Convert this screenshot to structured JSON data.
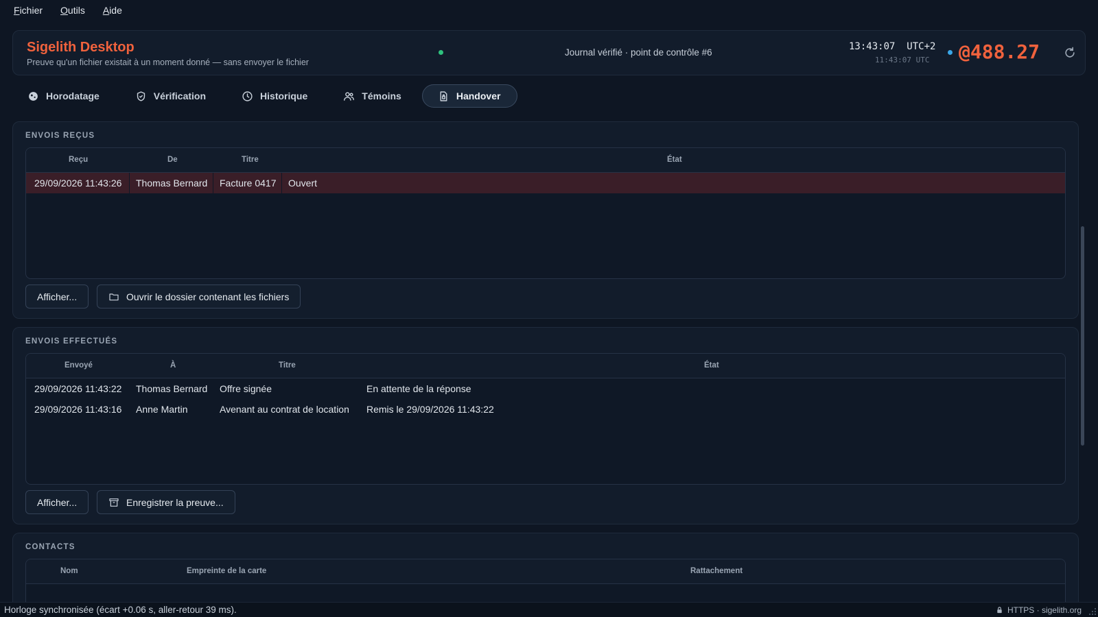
{
  "menu": [
    "Fichier",
    "Outils",
    "Aide"
  ],
  "header": {
    "title": "Sigelith Desktop",
    "subtitle": "Preuve qu'un fichier existait à un moment donné — sans envoyer le fichier",
    "journal": "Journal vérifié · point de contrôle #6",
    "clock_local": "13:43:07  UTC+2",
    "clock_utc": "11:43:07 UTC",
    "counter": "@488.27",
    "colors": {
      "accent": "#f0623d",
      "ok": "#2ec27e",
      "info": "#3aa7e8"
    }
  },
  "tabs": [
    {
      "label": "Horodatage",
      "icon": "seal-icon"
    },
    {
      "label": "Vérification",
      "icon": "shield-check-icon"
    },
    {
      "label": "Historique",
      "icon": "clock-icon"
    },
    {
      "label": "Témoins",
      "icon": "users-icon"
    },
    {
      "label": "Handover",
      "icon": "lock-file-icon",
      "active": true
    }
  ],
  "received": {
    "title": "ENVOIS REÇUS",
    "columns": [
      "Reçu",
      "De",
      "Titre",
      "État"
    ],
    "rows": [
      [
        "29/09/2026 11:43:26",
        "Thomas Bernard",
        "Facture 0417",
        "Ouvert"
      ]
    ],
    "show_button": "Afficher...",
    "open_folder_button": "Ouvrir le dossier contenant les fichiers"
  },
  "sent": {
    "title": "ENVOIS EFFECTUÉS",
    "columns": [
      "Envoyé",
      "À",
      "Titre",
      "État"
    ],
    "rows": [
      [
        "29/09/2026 11:43:22",
        "Thomas Bernard",
        "Offre signée",
        "En attente de la réponse"
      ],
      [
        "29/09/2026 11:43:16",
        "Anne Martin",
        "Avenant au contrat de location",
        "Remis le 29/09/2026 11:43:22"
      ]
    ],
    "show_button": "Afficher...",
    "save_proof_button": "Enregistrer la preuve..."
  },
  "contacts": {
    "title": "CONTACTS",
    "columns": [
      "Nom",
      "Empreinte de la carte",
      "Rattachement"
    ]
  },
  "statusbar": {
    "left": "Horloge synchronisée (écart +0.06 s, aller-retour 39 ms).",
    "right": "HTTPS · sigelith.org"
  }
}
